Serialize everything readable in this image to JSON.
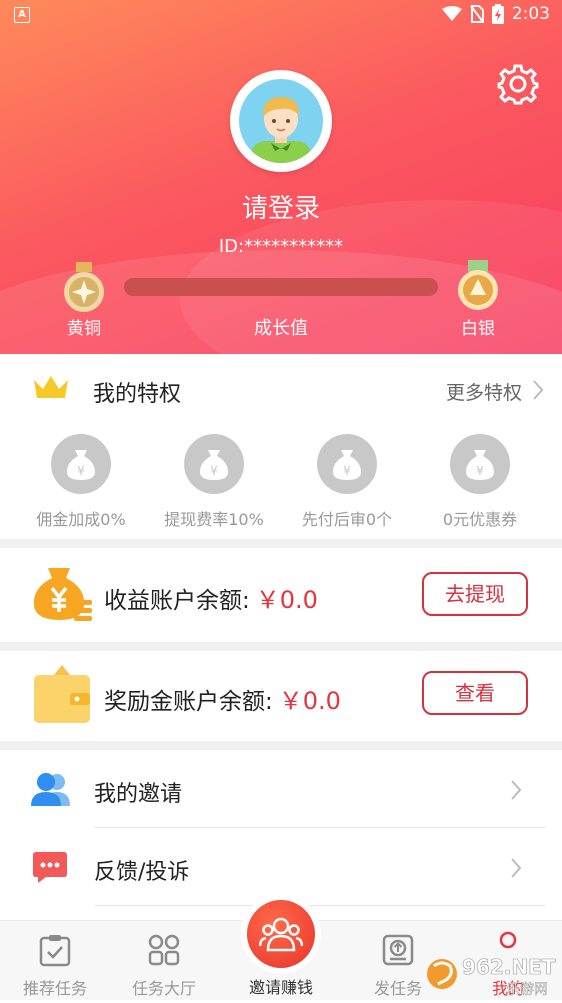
{
  "status_bar": {
    "time": "2:03",
    "notif_icon": "A"
  },
  "profile": {
    "login_text": "请登录",
    "id_text": "ID:***********",
    "level_current": "黄铜",
    "level_next": "白银",
    "growth_label": "成长值",
    "growth_progress": 0
  },
  "privileges": {
    "title": "我的特权",
    "more": "更多特权",
    "items": [
      {
        "label": "佣金加成0%"
      },
      {
        "label": "提现费率10%"
      },
      {
        "label": "先付后审0个"
      },
      {
        "label": "0元优惠券"
      }
    ],
    "coin_symbol": "¥"
  },
  "accounts": {
    "earnings_label": "收益账户余额:",
    "earnings_value": "￥0.0",
    "earnings_button": "去提现",
    "reward_label": "奖励金账户余额:",
    "reward_value": "￥0.0",
    "reward_button": "查看"
  },
  "menu": {
    "items": [
      {
        "label": "我的邀请",
        "icon": "users-icon"
      },
      {
        "label": "反馈/投诉",
        "icon": "chat-icon"
      }
    ]
  },
  "tabbar": {
    "tabs": [
      {
        "label": "推荐任务",
        "icon": "clipboard-check-icon"
      },
      {
        "label": "任务大厅",
        "icon": "grid-icon"
      },
      {
        "label": "邀请赚钱",
        "icon": "invite-icon"
      },
      {
        "label": "发任务",
        "icon": "upload-icon"
      },
      {
        "label": "我的",
        "icon": "person-icon"
      }
    ]
  },
  "watermark": {
    "brand": "962.NET",
    "sub": "乐游网"
  },
  "colors": {
    "accent": "#e8333e",
    "header_start": "#ff8a5a",
    "header_end": "#f83a5f"
  }
}
